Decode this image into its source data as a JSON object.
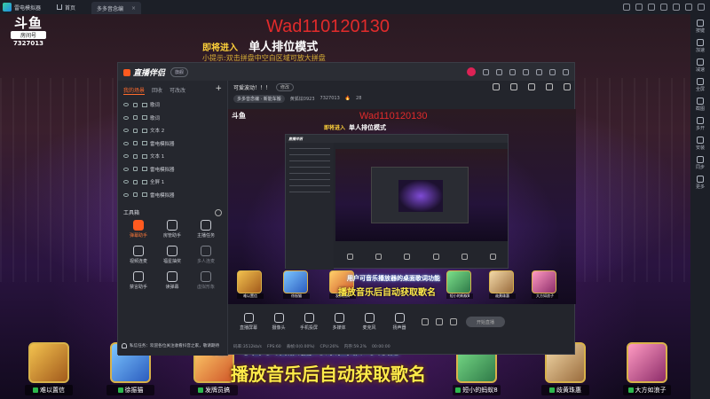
{
  "emulator": {
    "title": "雷电模拟器",
    "tab_home": "首页",
    "tab_active": "多多音念编"
  },
  "sidebar": {
    "items": [
      "按键",
      "加速",
      "减速",
      "全屏",
      "截图",
      "多开",
      "安装",
      "同步",
      "更多"
    ]
  },
  "stream": {
    "douyu_logo": "斗鱼",
    "room_label": "房间号",
    "room_id": "7327013",
    "room_code": "Wad110120130",
    "mode_prefix": "即将进入",
    "mode_title": "单人排位模式",
    "sub_line": "小提示:双击拼盘中空白区域可放大拼盘",
    "marquee": "用户可音乐播放器的桌面歌词功能",
    "song_text": "播放音乐后自动获取歌名",
    "heroes": [
      "难以置信",
      "徐振猫",
      "发牌员搞",
      "短小的蚂蚁8",
      "歧黄珠惠",
      "大方如浪子"
    ]
  },
  "app": {
    "brand": "直播伴侣",
    "version_badge": "旗舰",
    "left_tabs": [
      "我的场景",
      "回收",
      "可改改"
    ],
    "sources": [
      "歌词",
      "歌词",
      "文本 2",
      "雷电模拟器",
      "文本 1",
      "雷电模拟器",
      "全屏 1",
      "雷电模拟器"
    ],
    "tools_title": "工具箱",
    "tools": [
      {
        "label": "弹幕助手",
        "state": "hot"
      },
      {
        "label": "房管助手",
        "state": "normal"
      },
      {
        "label": "主播任务",
        "state": "normal"
      },
      {
        "label": "视频连麦",
        "state": "normal"
      },
      {
        "label": "福星抽奖",
        "state": "normal"
      },
      {
        "label": "多人连麦",
        "state": "dim"
      },
      {
        "label": "禁言助手",
        "state": "normal"
      },
      {
        "label": "读弹幕",
        "state": "normal"
      },
      {
        "label": "虚拟形象",
        "state": "dim"
      }
    ],
    "stream_title": "可爱波动！！！",
    "edit_label": "修改",
    "info_chip": "多多音念编 · 新能车搬",
    "info_user": "黄狐炫0923",
    "info_room": "7327013",
    "info_hot": "28",
    "controls": [
      "直播屏幕",
      "摄像头",
      "手机投屏",
      "多媒体",
      "麦克风",
      "扬声器"
    ],
    "start_live": "开始直播",
    "status": [
      "码率:3512kb/s",
      "FPS:60",
      "丢帧:0(0.00%)",
      "CPU:26%",
      "内存:59.2%",
      "00:00:00"
    ],
    "notice": "私信任务：欢迎各位关注收看抖音之家，敬请期待"
  }
}
